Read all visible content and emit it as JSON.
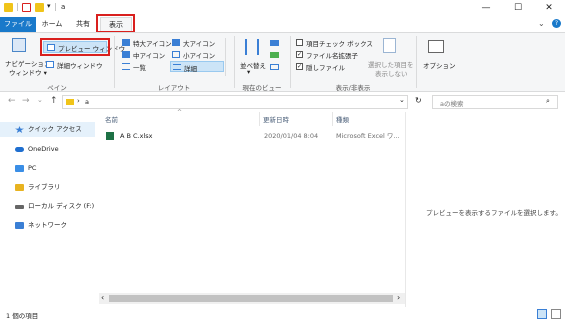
{
  "titlebar": {
    "title": "a",
    "separator": "|",
    "dropdown_glyph": "▾",
    "minimize": "—",
    "maximize": "☐",
    "close": "✕",
    "colors": {
      "folder": "#f0c419",
      "check": "#e8b320"
    }
  },
  "tabs": {
    "file": "ファイル",
    "home": "ホーム",
    "share": "共有",
    "view": "表示",
    "collapse_glyph": "⌄",
    "help_glyph": "?",
    "highlight_color": "#d9201e"
  },
  "ribbon": {
    "pane_group": {
      "nav_pane_line1": "ナビゲーション",
      "nav_pane_line2": "ウィンドウ ▾",
      "preview_pane": "プレビュー ウィンドウ",
      "details_pane": "詳細ウィンドウ",
      "group_label": "ペイン"
    },
    "layout_group": {
      "extra_large_icons": "特大アイコン",
      "large_icons": "大アイコン",
      "medium_icons": "中アイコン",
      "small_icons": "小アイコン",
      "list": "一覧",
      "details": "詳細",
      "group_label": "レイアウト"
    },
    "current_view_group": {
      "sort_by": "並べ替え",
      "sort_dropdown": "▾",
      "group_label": "現在のビュー"
    },
    "show_hide_group": {
      "item_check_boxes": "項目チェック ボックス",
      "file_name_extensions": "ファイル名拡張子",
      "hidden_items": "隠しファイル",
      "hide_selected_line1": "選択した項目を",
      "hide_selected_line2": "表示しない",
      "group_label": "表示/非表示",
      "checked_glyph": "✓"
    },
    "options": "オプション"
  },
  "address_bar": {
    "back": "←",
    "forward": "→",
    "recent": "⌄",
    "up": "↑",
    "chevron": "›",
    "path": "a",
    "dropdown": "⌄",
    "refresh": "↻",
    "search_placeholder": "aの検索",
    "search_icon": "⌕"
  },
  "nav_pane": {
    "items": [
      {
        "label": "クイック アクセス",
        "icon": "star-icon",
        "color": "#3a7fd5"
      },
      {
        "label": "OneDrive",
        "icon": "cloud-icon",
        "color": "#1f6fd0"
      },
      {
        "label": "PC",
        "icon": "monitor-icon",
        "color": "#3a8ee6"
      },
      {
        "label": "ライブラリ",
        "icon": "library-icon",
        "color": "#e8b320"
      },
      {
        "label": "ローカル ディスク (F:)",
        "icon": "drive-icon",
        "color": "#666666"
      },
      {
        "label": "ネットワーク",
        "icon": "network-icon",
        "color": "#3a7fd5"
      }
    ]
  },
  "file_list": {
    "sort_glyph": "^",
    "columns": {
      "name": "名前",
      "date": "更新日時",
      "type": "種類"
    },
    "rows": [
      {
        "name": "A B C.xlsx",
        "date": "2020/01/04 8:04",
        "type": "Microsoft Excel ワ..."
      }
    ],
    "scroll_left": "‹",
    "scroll_right": "›"
  },
  "preview_pane": {
    "message": "プレビューを表示するファイルを選択します。"
  },
  "status_bar": {
    "item_count": "1 個の項目"
  }
}
